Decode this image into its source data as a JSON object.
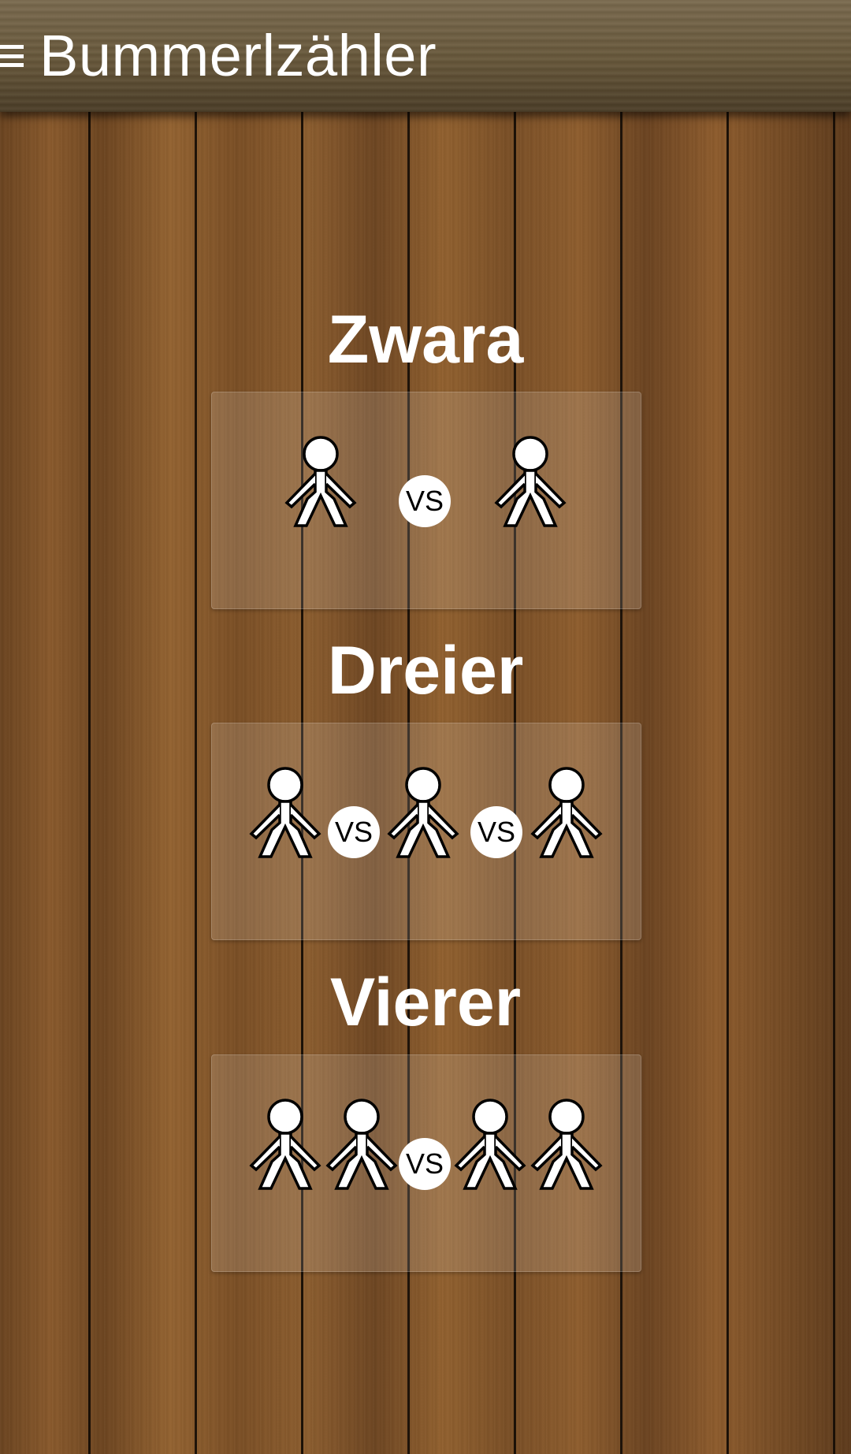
{
  "app_bar": {
    "title": "Bummerlzähler",
    "menu_icon": "hamburger-menu-icon"
  },
  "modes": [
    {
      "title": "Zwara",
      "players": 2,
      "vs_label": "VS"
    },
    {
      "title": "Dreier",
      "players": 3,
      "vs_label": "VS"
    },
    {
      "title": "Vierer",
      "players": 4,
      "vs_label": "VS"
    }
  ]
}
